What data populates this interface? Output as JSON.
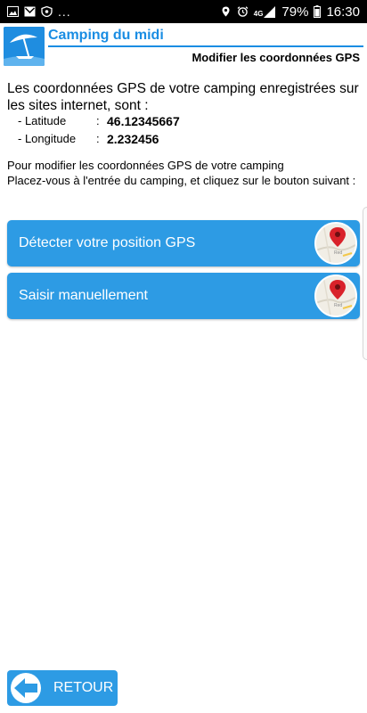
{
  "status_bar": {
    "dots": "...",
    "network": "4G",
    "battery": "79%",
    "time": "16:30"
  },
  "header": {
    "app_title": "Camping du midi",
    "page_title": "Modifier les coordonnées GPS"
  },
  "content": {
    "intro": "Les coordonnées GPS de votre camping enregistrées sur les sites internet, sont :",
    "coordinates": [
      {
        "label": "- Latitude",
        "sep": ":",
        "value": "46.12345667"
      },
      {
        "label": "- Longitude",
        "sep": ":",
        "value": "2.232456"
      }
    ],
    "instructions_line1": "Pour modifier les coordonnées GPS de votre camping",
    "instructions_line2": "Placez-vous à l'entrée du camping, et cliquez sur le bouton suivant :"
  },
  "actions": {
    "detect_label": "Détecter votre position GPS",
    "manual_label": "Saisir manuellement"
  },
  "footer": {
    "back_label": "RETOUR"
  },
  "colors": {
    "accent": "#1a8de3",
    "button": "#2d9be4",
    "pin": "#d9222a"
  },
  "icons": [
    "gallery-icon",
    "mail-icon",
    "vpn-icon",
    "location-icon",
    "alarm-icon",
    "signal-icon",
    "battery-icon",
    "beach-umbrella-logo",
    "map-pin-icon",
    "back-arrow-icon"
  ]
}
